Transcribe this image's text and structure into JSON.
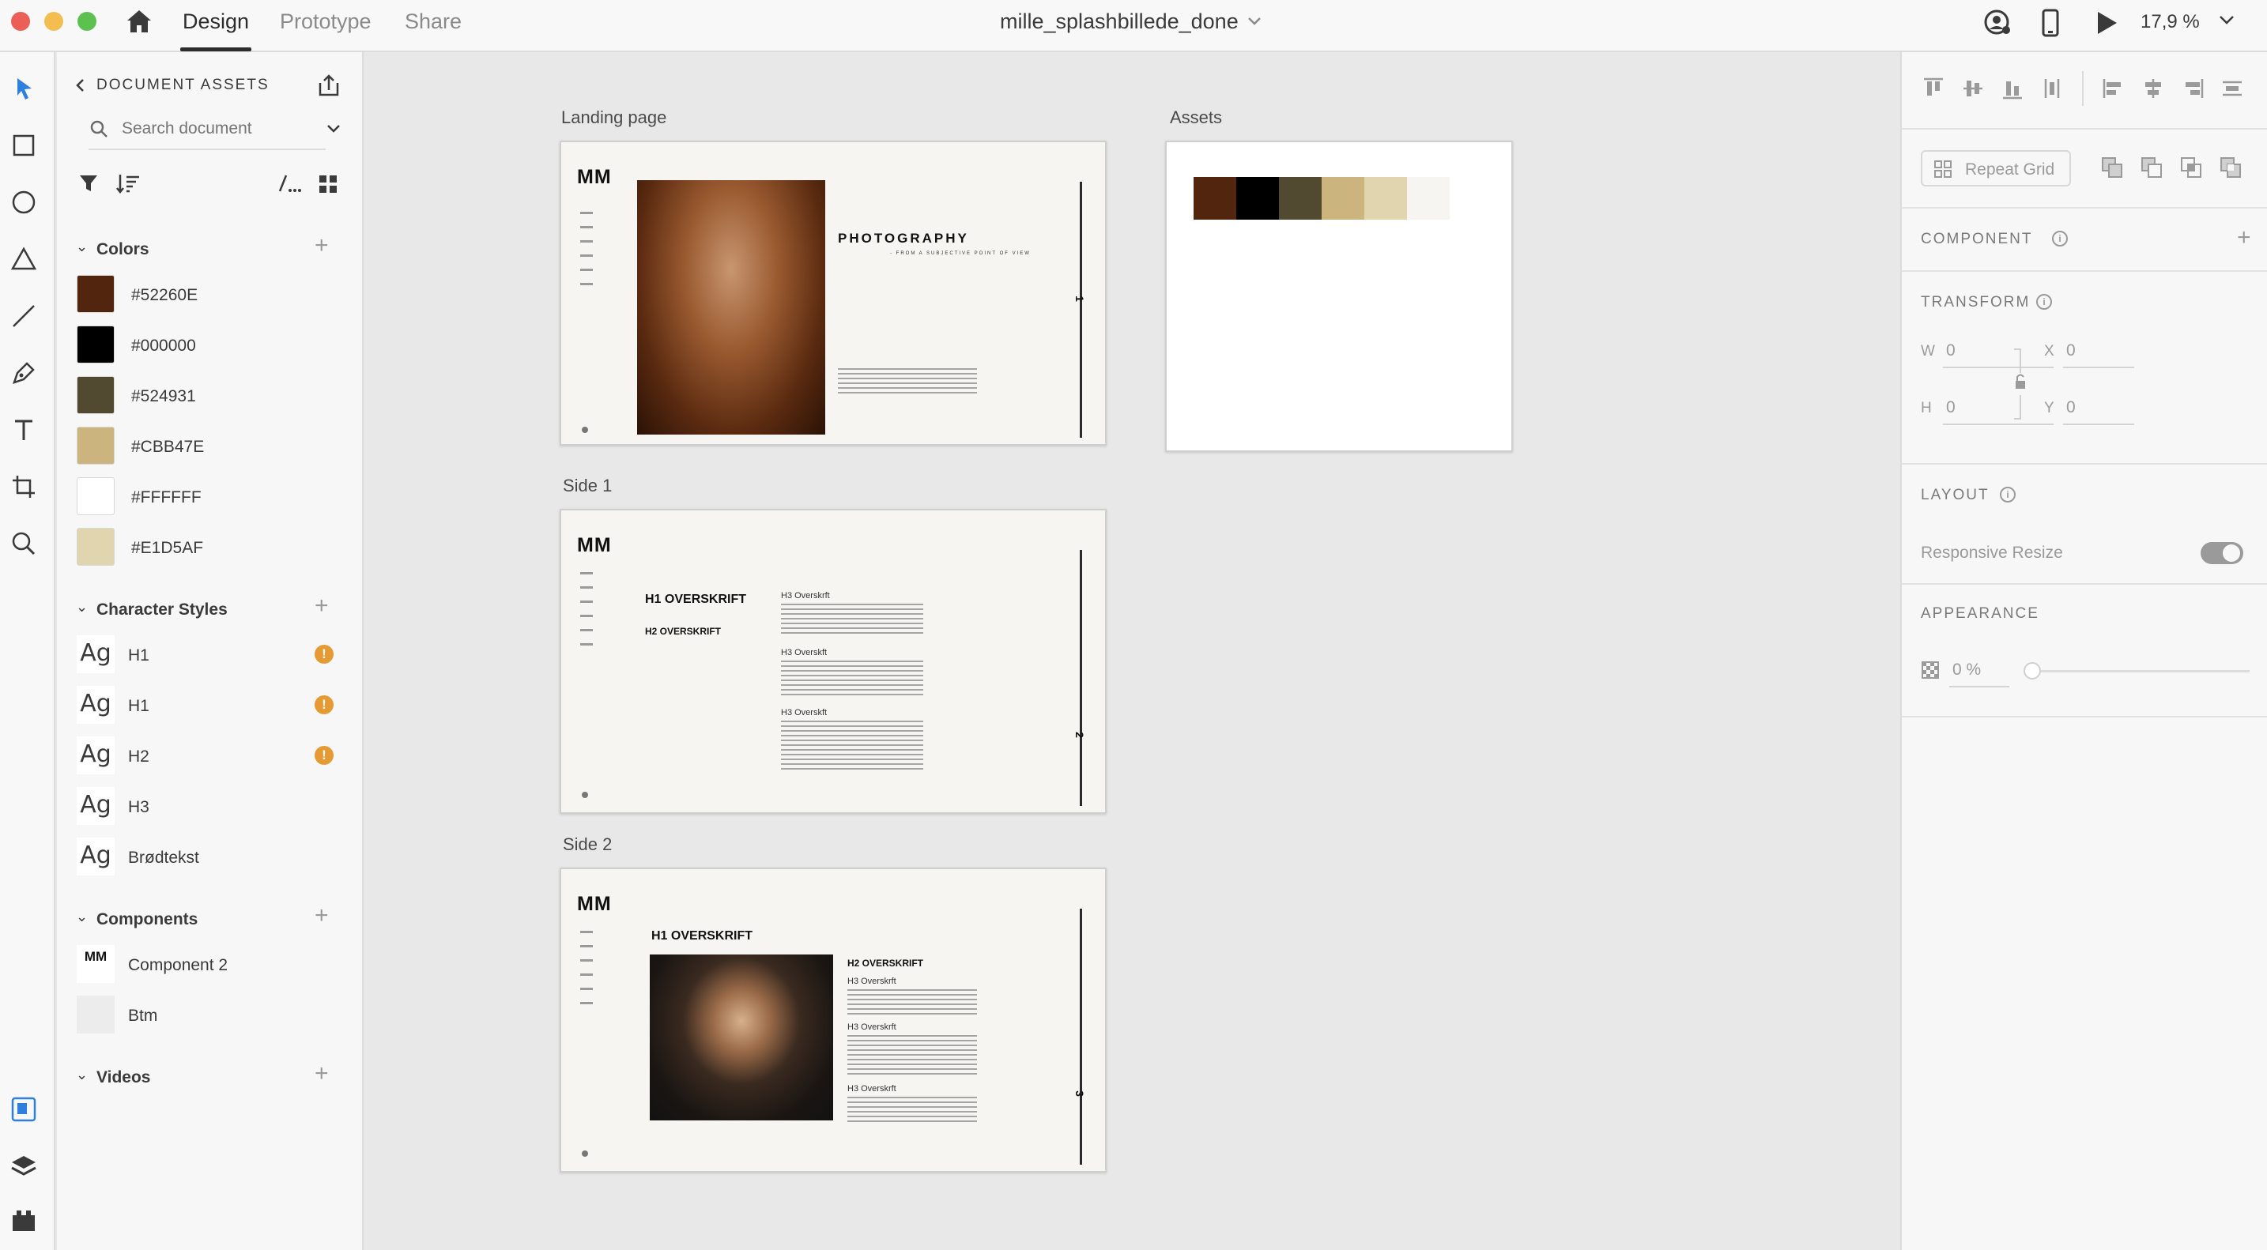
{
  "topbar": {
    "tabs": [
      {
        "label": "Design"
      },
      {
        "label": "Prototype"
      },
      {
        "label": "Share"
      }
    ],
    "doc_title": "mille_splashbillede_done",
    "zoom": "17,9 %"
  },
  "assets": {
    "header": "DOCUMENT ASSETS",
    "search_placeholder": "Search document",
    "colors": {
      "title": "Colors",
      "items": [
        {
          "hex": "#52260E"
        },
        {
          "hex": "#000000"
        },
        {
          "hex": "#524931"
        },
        {
          "hex": "#CBB47E"
        },
        {
          "hex": "#FFFFFF"
        },
        {
          "hex": "#E1D5AF"
        }
      ]
    },
    "character_styles": {
      "title": "Character Styles",
      "sample": "Ag",
      "items": [
        {
          "label": "H1",
          "warning": true
        },
        {
          "label": "H1",
          "warning": true
        },
        {
          "label": "H2",
          "warning": true
        },
        {
          "label": "H3",
          "warning": false
        },
        {
          "label": "Brødtekst",
          "warning": false
        }
      ]
    },
    "components": {
      "title": "Components",
      "items": [
        {
          "label": "Component 2",
          "thumb": "MM"
        },
        {
          "label": "Btm",
          "thumb": ""
        }
      ]
    },
    "videos": {
      "title": "Videos"
    }
  },
  "canvas": {
    "artboards": [
      {
        "label": "Landing page",
        "logo": "MM",
        "heading": "PHOTOGRAPHY",
        "subheading": "- FROM A SUBJECTIVE POINT OF VIEW",
        "page": "1"
      },
      {
        "label": "Side 1",
        "logo": "MM",
        "h1": "H1 OVERSKRIFT",
        "h2": "H2 OVERSKRIFT",
        "h3": [
          "H3 Overskrft",
          "H3 Overskft",
          "H3 Overskft"
        ],
        "page": "2"
      },
      {
        "label": "Side 2",
        "logo": "MM",
        "h1": "H1 OVERSKRIFT",
        "h2": "H2 OVERSKRIFT",
        "h3": [
          "H3 Overskrft",
          "H3 Overskrft",
          "H3 Overskrft"
        ],
        "page": "3"
      },
      {
        "label": "Assets",
        "palette": [
          "#52260E",
          "#000000",
          "#524931",
          "#CBB47E",
          "#E1D5AF",
          "#F6F5F1"
        ]
      }
    ]
  },
  "props": {
    "repeat_grid": "Repeat Grid",
    "component": "COMPONENT",
    "transform": "TRANSFORM",
    "w_label": "W",
    "w_value": "0",
    "h_label": "H",
    "h_value": "0",
    "x_label": "X",
    "x_value": "0",
    "y_label": "Y",
    "y_value": "0",
    "layout": "LAYOUT",
    "responsive_resize": "Responsive Resize",
    "appearance": "APPEARANCE",
    "opacity": "0 %"
  }
}
